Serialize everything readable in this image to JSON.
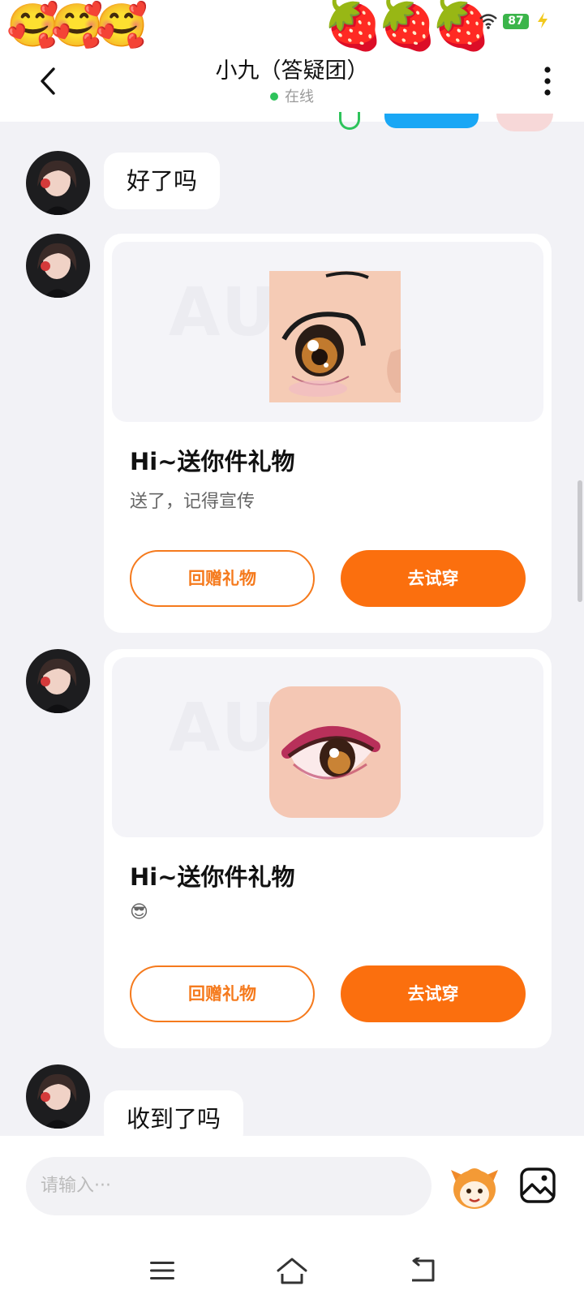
{
  "status_bar": {
    "left_emoji": "🥰🥰🥰",
    "right_emoji": "🍓🍓🍓",
    "battery_level": "87"
  },
  "header": {
    "title": "小九（答疑团）",
    "status": "在线"
  },
  "messages": [
    {
      "type": "text",
      "text": "好了吗"
    },
    {
      "type": "gift",
      "watermark": "AU   R",
      "title": "Hi~送你件礼物",
      "message": "送了，记得宣传",
      "return_gift_label": "回赠礼物",
      "try_on_label": "去试穿"
    },
    {
      "type": "gift",
      "watermark": "AU   R",
      "title": "Hi~送你件礼物",
      "message": "😎",
      "return_gift_label": "回赠礼物",
      "try_on_label": "去试穿"
    },
    {
      "type": "text",
      "text": "收到了吗"
    }
  ],
  "input": {
    "placeholder": "请输入···"
  },
  "colors": {
    "accent": "#fb6f0e",
    "online": "#2ec35b",
    "background": "#f2f2f6"
  }
}
